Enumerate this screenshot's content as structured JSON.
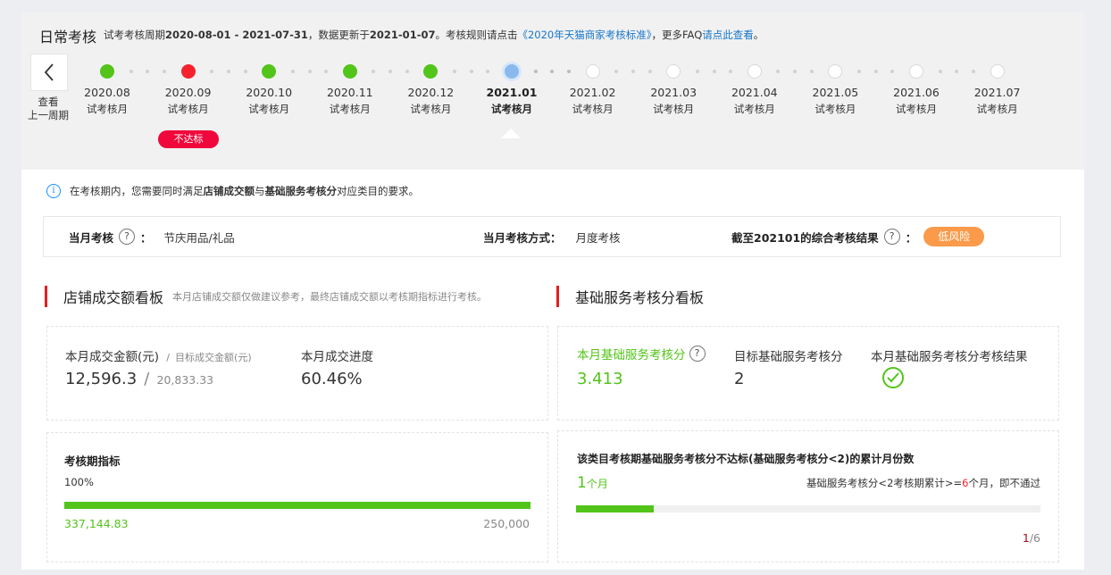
{
  "header": {
    "title": "日常考核",
    "subtitle_pre": "试考考核周期",
    "period": "2020-08-01 - 2021-07-31",
    "subtitle_mid": "，数据更新于",
    "updated": "2021-01-07",
    "subtitle_rule": "。考核规则请点击",
    "rule_link": "《2020年天猫商家考核标准》",
    "subtitle_faq": "，更多FAQ",
    "faq_link": "请点此查看",
    "subtitle_end": "。"
  },
  "prev": {
    "label_line1": "查看",
    "label_line2": "上一周期"
  },
  "timeline": {
    "months": [
      {
        "label": "2020.08",
        "sub": "试考核月",
        "status": "green"
      },
      {
        "label": "2020.09",
        "sub": "试考核月",
        "status": "red"
      },
      {
        "label": "2020.10",
        "sub": "试考核月",
        "status": "green"
      },
      {
        "label": "2020.11",
        "sub": "试考核月",
        "status": "green"
      },
      {
        "label": "2020.12",
        "sub": "试考核月",
        "status": "green"
      },
      {
        "label": "2021.01",
        "sub": "试考核月",
        "status": "current"
      },
      {
        "label": "2021.02",
        "sub": "试考核月",
        "status": "empty"
      },
      {
        "label": "2021.03",
        "sub": "试考核月",
        "status": "empty"
      },
      {
        "label": "2021.04",
        "sub": "试考核月",
        "status": "empty"
      },
      {
        "label": "2021.05",
        "sub": "试考核月",
        "status": "empty"
      },
      {
        "label": "2021.06",
        "sub": "试考核月",
        "status": "empty"
      },
      {
        "label": "2021.07",
        "sub": "试考核月",
        "status": "empty"
      }
    ],
    "fail_badge": "不达标"
  },
  "info": {
    "text1": "在考核期内，您需要同时满足",
    "bold1": "店铺成交额",
    "text2": "与",
    "bold2": "基础服务考核分",
    "text3": "对应类目的要求。"
  },
  "summary": {
    "month_label": "当月考核",
    "month_value": "节庆用品/礼品",
    "method_label": "当月考核方式：",
    "method_value": "月度考核",
    "result_label": "截至202101的综合考核结果",
    "result_value": "低风险"
  },
  "sales": {
    "title": "店铺成交额看板",
    "note": "本月店铺成交额仅做建议参考，最终店铺成交额以考核期指标进行考核。",
    "amount_label": "本月成交金额(元)",
    "target_label": "目标成交金额(元)",
    "amount": "12,596.3",
    "target": "20,833.33",
    "progress_label": "本月成交进度",
    "progress_value": "60.46%",
    "period_title": "考核期指标",
    "period_pct": "100%",
    "period_progress": 1.0,
    "period_actual": "337,144.83",
    "period_target": "250,000"
  },
  "service": {
    "title": "基础服务考核分看板",
    "score_label": "本月基础服务考核分",
    "score": "3.413",
    "target_label": "目标基础服务考核分",
    "target": "2",
    "result_label": "本月基础服务考核分考核结果",
    "fail_title": "该类目考核期基础服务考核分不达标(基础服务考核分<2)的累计月份数",
    "fail_count": "1",
    "fail_unit": "个月",
    "rule_pre": "基础服务考核分<2考核期累计>=",
    "rule_num": "6",
    "rule_post": "个月，即不通过",
    "fail_progress": 0.1667,
    "ratio_num": "1",
    "ratio_den": "/6"
  },
  "colors": {
    "green": "#52c41a",
    "red": "#f0073b",
    "orange": "#fa9a4a",
    "link": "#1677c8",
    "section_bar": "#e02020"
  }
}
